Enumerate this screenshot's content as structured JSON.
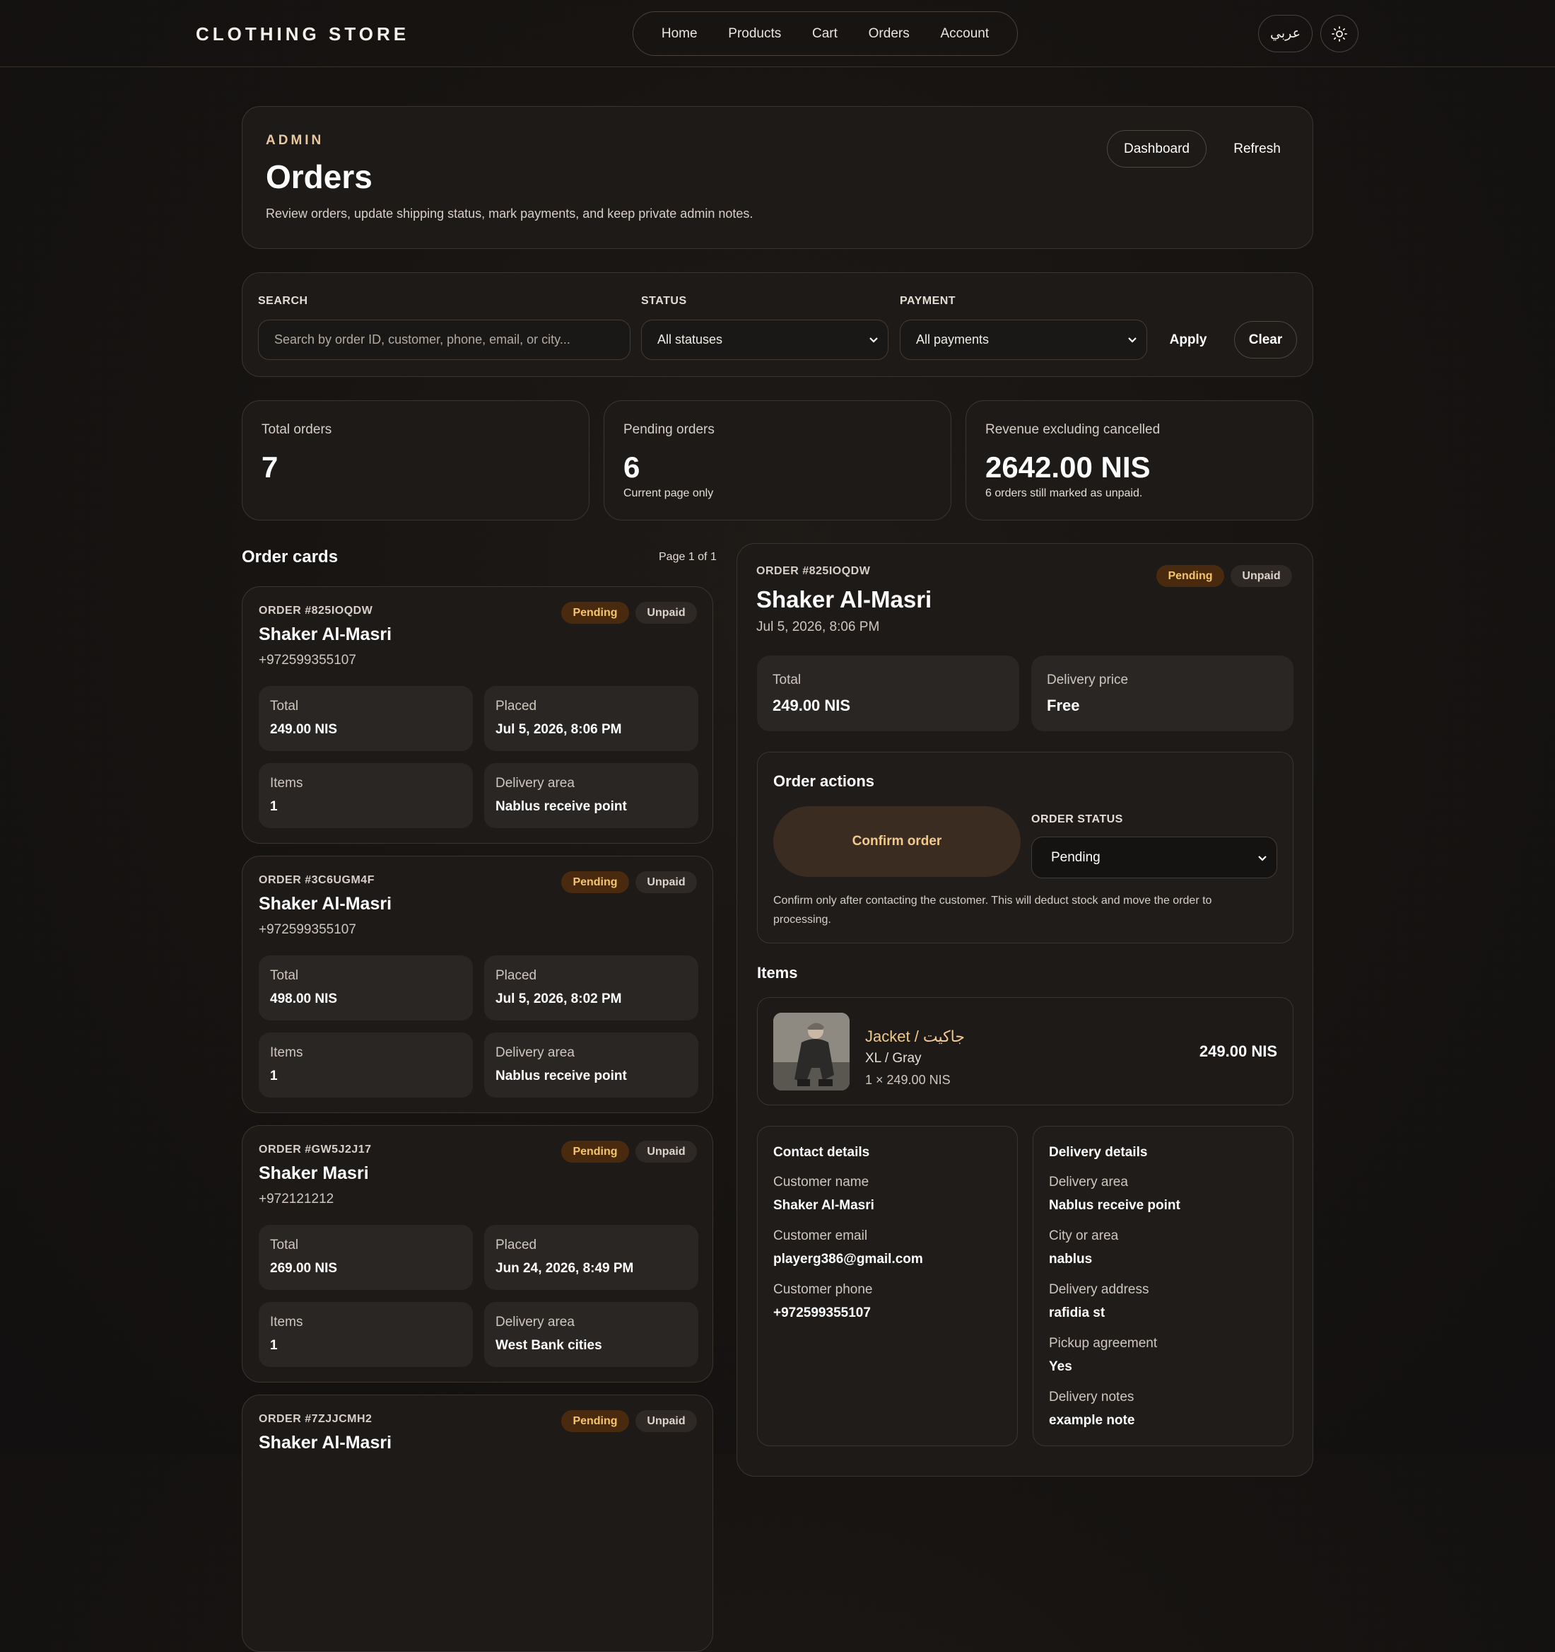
{
  "brand": "CLOTHING STORE",
  "nav": {
    "items": [
      {
        "label": "Home"
      },
      {
        "label": "Products"
      },
      {
        "label": "Cart"
      },
      {
        "label": "Orders"
      },
      {
        "label": "Account"
      }
    ],
    "lang_label": "عربي",
    "theme_icon": "sun-icon"
  },
  "header": {
    "eyebrow": "ADMIN",
    "title": "Orders",
    "subtitle": "Review orders, update shipping status, mark payments, and keep private admin notes.",
    "dashboard_label": "Dashboard",
    "refresh_label": "Refresh"
  },
  "filters": {
    "search_label": "SEARCH",
    "search_placeholder": "Search by order ID, customer, phone, email, or city...",
    "status_label": "STATUS",
    "status_value": "All statuses",
    "payment_label": "PAYMENT",
    "payment_value": "All payments",
    "apply_label": "Apply",
    "clear_label": "Clear"
  },
  "stats": {
    "total": {
      "label": "Total orders",
      "value": "7"
    },
    "pending": {
      "label": "Pending orders",
      "value": "6",
      "note": "Current page only"
    },
    "revenue": {
      "label": "Revenue excluding cancelled",
      "value": "2642.00 NIS",
      "note": "6 orders still marked as unpaid."
    }
  },
  "orders_section": {
    "title": "Order cards",
    "page_info": "Page 1 of 1",
    "cards": [
      {
        "number": "ORDER #825IOQDW",
        "name": "Shaker Al-Masri",
        "phone": "+972599355107",
        "status": "Pending",
        "payment": "Unpaid",
        "total_label": "Total",
        "total": "249.00 NIS",
        "placed_label": "Placed",
        "placed": "Jul 5, 2026, 8:06 PM",
        "items_label": "Items",
        "items": "1",
        "area_label": "Delivery area",
        "area": "Nablus receive point"
      },
      {
        "number": "ORDER #3C6UGM4F",
        "name": "Shaker Al-Masri",
        "phone": "+972599355107",
        "status": "Pending",
        "payment": "Unpaid",
        "total_label": "Total",
        "total": "498.00 NIS",
        "placed_label": "Placed",
        "placed": "Jul 5, 2026, 8:02 PM",
        "items_label": "Items",
        "items": "1",
        "area_label": "Delivery area",
        "area": "Nablus receive point"
      },
      {
        "number": "ORDER #GW5J2J17",
        "name": "Shaker Masri",
        "phone": "+972121212",
        "status": "Pending",
        "payment": "Unpaid",
        "total_label": "Total",
        "total": "269.00 NIS",
        "placed_label": "Placed",
        "placed": "Jun 24, 2026, 8:49 PM",
        "items_label": "Items",
        "items": "1",
        "area_label": "Delivery area",
        "area": "West Bank cities"
      },
      {
        "number": "ORDER #7ZJJCMH2",
        "name": "Shaker Al-Masri",
        "status": "Pending",
        "payment": "Unpaid"
      }
    ]
  },
  "detail": {
    "number": "ORDER #825IOQDW",
    "status": "Pending",
    "payment": "Unpaid",
    "name": "Shaker Al-Masri",
    "date": "Jul 5, 2026, 8:06 PM",
    "total_label": "Total",
    "total": "249.00 NIS",
    "delivery_price_label": "Delivery price",
    "delivery_price": "Free",
    "actions": {
      "title": "Order actions",
      "confirm_label": "Confirm order",
      "order_status_label": "ORDER STATUS",
      "order_status_value": "Pending",
      "help": "Confirm only after contacting the customer. This will deduct stock and move the order to processing."
    },
    "items_title": "Items",
    "item": {
      "name": "Jacket / جاكيت",
      "variant": "XL / Gray",
      "qty": "1 × 249.00 NIS",
      "price": "249.00 NIS"
    },
    "contact": {
      "title": "Contact details",
      "rows": [
        {
          "k": "Customer name",
          "v": "Shaker Al-Masri"
        },
        {
          "k": "Customer email",
          "v": "playerg386@gmail.com"
        },
        {
          "k": "Customer phone",
          "v": "+972599355107"
        }
      ]
    },
    "delivery": {
      "title": "Delivery details",
      "rows": [
        {
          "k": "Delivery area",
          "v": "Nablus receive point"
        },
        {
          "k": "City or area",
          "v": "nablus"
        },
        {
          "k": "Delivery address",
          "v": "rafidia st"
        },
        {
          "k": "Pickup agreement",
          "v": "Yes"
        },
        {
          "k": "Delivery notes",
          "v": "example note"
        }
      ]
    }
  },
  "colors": {
    "accent": "#f0c98f",
    "pending_badge_bg": "#4a2a0e",
    "pending_badge_text": "#f4c56d",
    "background": "#161311"
  }
}
